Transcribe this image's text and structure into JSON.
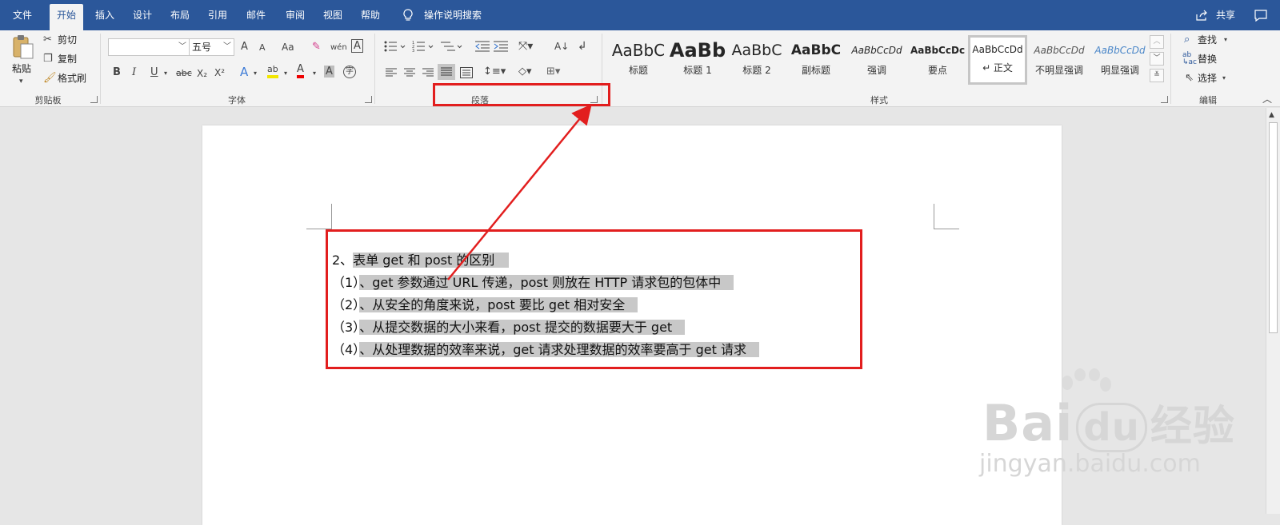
{
  "tabs": {
    "file": "文件",
    "home": "开始",
    "insert": "插入",
    "design": "设计",
    "layout": "布局",
    "references": "引用",
    "mailings": "邮件",
    "review": "审阅",
    "view": "视图",
    "help": "帮助",
    "tell_me": "操作说明搜索",
    "share": "共享"
  },
  "clipboard": {
    "paste": "粘贴",
    "cut": "剪切",
    "copy": "复制",
    "format_painter": "格式刷",
    "label": "剪贴板"
  },
  "font": {
    "font_name": "",
    "font_size": "五号",
    "grow": "A",
    "shrink": "A",
    "change_case": "Aa",
    "phonetic": "wén",
    "border": "A",
    "bold": "B",
    "italic": "I",
    "underline": "U",
    "strike": "abc",
    "subscript": "X₂",
    "superscript": "X²",
    "text_effects": "A",
    "highlight": "ab",
    "font_color": "A",
    "shading": "A",
    "enclose": "字",
    "label": "字体"
  },
  "paragraph": {
    "label": "段落"
  },
  "styles": {
    "items": [
      {
        "sample": "AaBbC",
        "name": "标题"
      },
      {
        "sample": "AaBb",
        "name": "标题 1"
      },
      {
        "sample": "AaBbC",
        "name": "标题 2"
      },
      {
        "sample": "AaBbC",
        "name": "副标题"
      },
      {
        "sample": "AaBbCcDd",
        "name": "强调"
      },
      {
        "sample": "AaBbCcDc",
        "name": "要点"
      },
      {
        "sample": "AaBbCcDd",
        "name": "↵ 正文"
      },
      {
        "sample": "AaBbCcDd",
        "name": "不明显强调"
      },
      {
        "sample": "AaBbCcDd",
        "name": "明显强调"
      }
    ],
    "label": "样式"
  },
  "editing": {
    "find": "查找",
    "replace": "替换",
    "select": "选择",
    "label": "编辑"
  },
  "document": {
    "lines": [
      {
        "prefix": "2、",
        "text": "表单 get 和 post 的区别"
      },
      {
        "prefix": "（1）",
        "text": "、get 参数通过 URL 传递，post 则放在 HTTP 请求包的包体中"
      },
      {
        "prefix": "（2）",
        "text": "、从安全的角度来说，post 要比 get 相对安全"
      },
      {
        "prefix": "（3）",
        "text": "、从提交数据的大小来看，post 提交的数据要大于 get"
      },
      {
        "prefix": "（4）",
        "text": "、从处理数据的效率来说，get 请求处理数据的效率要高于 get 请求"
      }
    ]
  },
  "watermark": {
    "brand": "Bai",
    "brand2": "du",
    "suffix": "经验",
    "url": "jingyan.baidu.com"
  },
  "colors": {
    "tab_bar": "#2b579a",
    "annotation": "#e21e1e",
    "selection": "#c8c8c8"
  }
}
